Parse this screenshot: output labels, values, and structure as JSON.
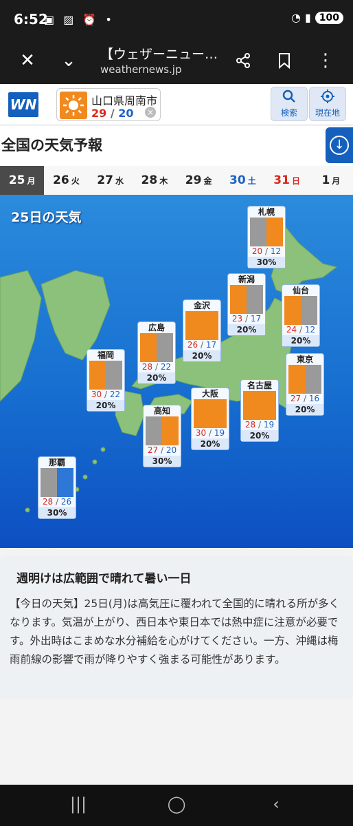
{
  "status_bar": {
    "time": "6:52",
    "battery": "100"
  },
  "browser": {
    "title": "【ウェザーニュー…",
    "url": "weathernews.jp"
  },
  "header": {
    "location": {
      "name": "山口県周南市",
      "high": "29",
      "low": "20",
      "icon": "sun-icon"
    },
    "search_label": "検索",
    "current_location_label": "現在地"
  },
  "page_title": "全国の天気予報",
  "date_tabs": [
    {
      "day": "25",
      "dow": "月",
      "active": true,
      "kind": "normal"
    },
    {
      "day": "26",
      "dow": "火",
      "active": false,
      "kind": "normal"
    },
    {
      "day": "27",
      "dow": "水",
      "active": false,
      "kind": "normal"
    },
    {
      "day": "28",
      "dow": "木",
      "active": false,
      "kind": "normal"
    },
    {
      "day": "29",
      "dow": "金",
      "active": false,
      "kind": "normal"
    },
    {
      "day": "30",
      "dow": "土",
      "active": false,
      "kind": "sat"
    },
    {
      "day": "31",
      "dow": "日",
      "active": false,
      "kind": "sun"
    },
    {
      "day": "1",
      "dow": "月",
      "active": false,
      "kind": "normal"
    }
  ],
  "map": {
    "title": "25日の天気",
    "cities": [
      {
        "name": "札幌",
        "high": "20",
        "low": "12",
        "pop": "30%",
        "weather": "cloudy-then-sunny"
      },
      {
        "name": "新潟",
        "high": "23",
        "low": "17",
        "pop": "20%",
        "weather": "sunny-then-cloudy"
      },
      {
        "name": "仙台",
        "high": "24",
        "low": "12",
        "pop": "20%",
        "weather": "sunny-then-cloudy"
      },
      {
        "name": "金沢",
        "high": "26",
        "low": "17",
        "pop": "20%",
        "weather": "sunny"
      },
      {
        "name": "広島",
        "high": "28",
        "low": "22",
        "pop": "20%",
        "weather": "sunny-then-cloudy"
      },
      {
        "name": "福岡",
        "high": "30",
        "low": "22",
        "pop": "20%",
        "weather": "sunny-then-cloudy"
      },
      {
        "name": "東京",
        "high": "27",
        "low": "16",
        "pop": "20%",
        "weather": "sunny-then-cloudy"
      },
      {
        "name": "名古屋",
        "high": "28",
        "low": "19",
        "pop": "20%",
        "weather": "sunny"
      },
      {
        "name": "大阪",
        "high": "30",
        "low": "19",
        "pop": "20%",
        "weather": "sunny"
      },
      {
        "name": "高知",
        "high": "27",
        "low": "20",
        "pop": "30%",
        "weather": "cloudy-then-sunny"
      },
      {
        "name": "那覇",
        "high": "28",
        "low": "26",
        "pop": "30%",
        "weather": "cloudy-then-rain"
      }
    ]
  },
  "article": {
    "headline": "週明けは広範囲で晴れて暑い一日",
    "body": "【今日の天気】25日(月)は高気圧に覆われて全国的に晴れる所が多くなります。気温が上がり、西日本や東日本では熱中症に注意が必要です。外出時はこまめな水分補給を心がけてください。一方、沖縄は梅雨前線の影響で雨が降りやすく強まる可能性があります。"
  },
  "colors": {
    "brand": "#1560bd",
    "sun": "#f08a1f",
    "cloud": "#9a9a9a",
    "rain": "#2d78d6",
    "high": "#d9291b",
    "low": "#1b63c4"
  }
}
